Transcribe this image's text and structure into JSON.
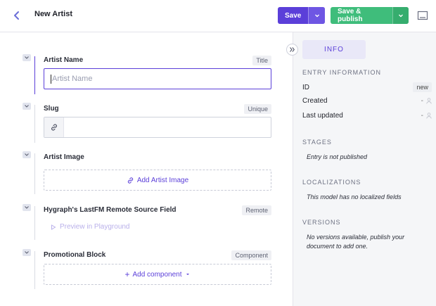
{
  "header": {
    "title": "New Artist",
    "save_label": "Save",
    "publish_label": "Save & publish"
  },
  "form": {
    "fields": [
      {
        "label": "Artist Name",
        "tag": "Title",
        "placeholder": "Artist Name"
      },
      {
        "label": "Slug",
        "tag": "Unique"
      },
      {
        "label": "Artist Image",
        "action": "Add Artist Image"
      },
      {
        "label": "Hygraph's LastFM Remote Source Field",
        "tag": "Remote",
        "action": "Preview in Playground"
      },
      {
        "label": "Promotional Block",
        "tag": "Component",
        "action": "Add component"
      }
    ]
  },
  "sidebar": {
    "tab": "INFO",
    "entry_info": {
      "heading": "ENTRY INFORMATION",
      "id_label": "ID",
      "id_value": "new",
      "created_label": "Created",
      "created_value": "-",
      "updated_label": "Last updated",
      "updated_value": "-"
    },
    "stages": {
      "heading": "STAGES",
      "text": "Entry is not published"
    },
    "localizations": {
      "heading": "LOCALIZATIONS",
      "text": "This model has no localized fields"
    },
    "versions": {
      "heading": "VERSIONS",
      "text": "No versions available, publish your document to add one."
    }
  },
  "colors": {
    "primary": "#5b3fd9",
    "publish": "#3fbd7b"
  }
}
